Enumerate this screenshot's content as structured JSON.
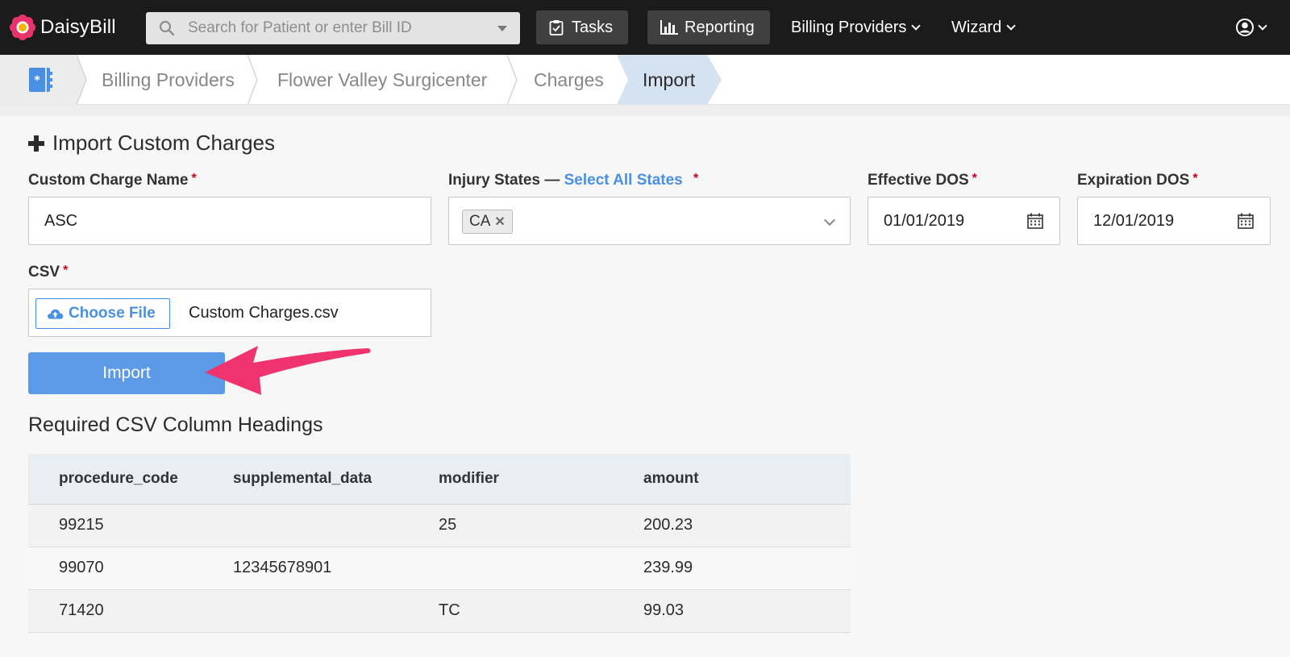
{
  "app": {
    "name": "DaisyBill"
  },
  "search": {
    "placeholder": "Search for Patient or enter Bill ID"
  },
  "nav": {
    "tasks": "Tasks",
    "reporting": "Reporting",
    "billing_providers": "Billing Providers",
    "wizard": "Wizard"
  },
  "breadcrumb": [
    "Billing Providers",
    "Flower Valley Surgicenter",
    "Charges",
    "Import"
  ],
  "form": {
    "title": "Import Custom Charges",
    "name_label": "Custom Charge Name",
    "name_value": "ASC",
    "states_label": "Injury States —",
    "states_link": "Select All States",
    "states_selected": [
      "CA"
    ],
    "effective_label": "Effective DOS",
    "effective_value": "01/01/2019",
    "expiration_label": "Expiration DOS",
    "expiration_value": "12/01/2019",
    "csv_label": "CSV",
    "choose_file": "Choose File",
    "file_name": "Custom Charges.csv",
    "import_button": "Import",
    "required_mark": "*"
  },
  "columns": {
    "title": "Required CSV Column Headings",
    "headers": [
      "procedure_code",
      "supplemental_data",
      "modifier",
      "amount"
    ],
    "rows": [
      [
        "99215",
        "",
        "25",
        "200.23"
      ],
      [
        "99070",
        "12345678901",
        "",
        "239.99"
      ],
      [
        "71420",
        "",
        "TC",
        "99.03"
      ]
    ]
  },
  "colors": {
    "topbar": "#1b1b1b",
    "accent": "#4a90e2",
    "import_button": "#5a9ae6",
    "arrow": "#f0336f",
    "required": "#d0021b",
    "active_crumb": "#d4e2f1"
  }
}
